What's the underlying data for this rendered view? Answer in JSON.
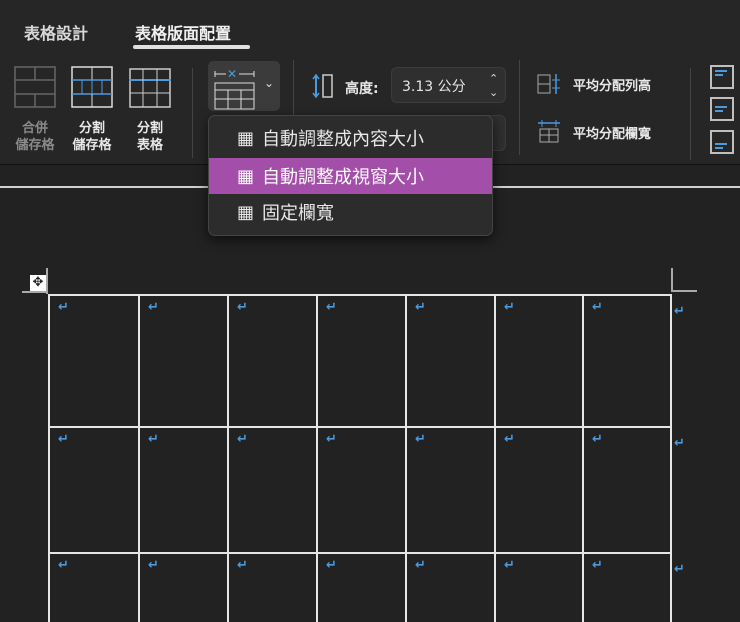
{
  "tabs": [
    {
      "label": "表格設計",
      "active": false
    },
    {
      "label": "表格版面配置",
      "active": true
    }
  ],
  "ribbon": {
    "merge_cells": {
      "line1": "合併",
      "line2": "儲存格",
      "enabled": false
    },
    "split_cells": {
      "line1": "分割",
      "line2": "儲存格"
    },
    "split_table": {
      "line1": "分割",
      "line2": "表格"
    },
    "autofit_icon": "table-autofit-icon",
    "height_label": "高度:",
    "height_value": "3.13 公分",
    "distribute_rows": "平均分配列高",
    "distribute_columns": "平均分配欄寬"
  },
  "autofit_menu": {
    "items": [
      {
        "label": "自動調整成內容大小",
        "highlighted": false
      },
      {
        "label": "自動調整成視窗大小",
        "highlighted": true
      },
      {
        "label": "固定欄寬",
        "highlighted": false
      }
    ]
  },
  "table": {
    "columns": 7,
    "visible_rows": 3,
    "cell_mark": "↵"
  },
  "colors": {
    "highlight": "#a34ea8",
    "accent": "#4a9ade"
  }
}
